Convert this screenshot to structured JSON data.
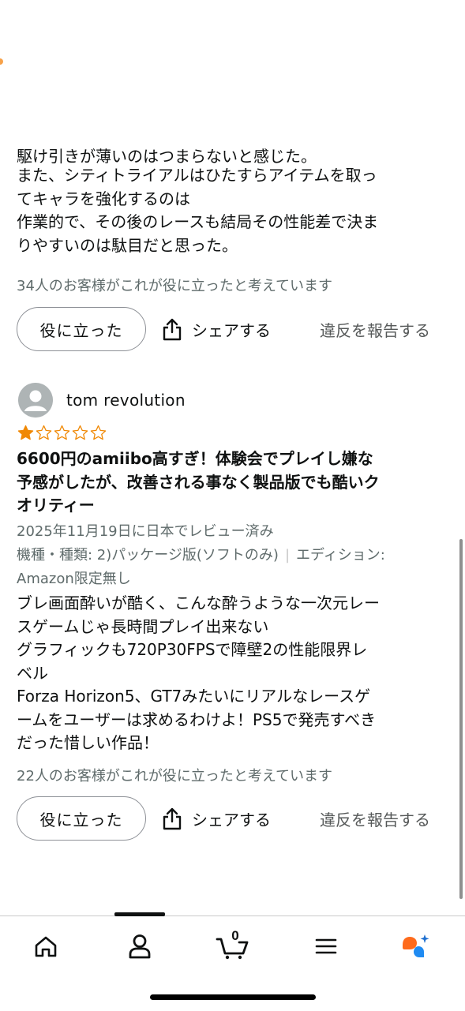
{
  "previous_review": {
    "body_lines": [
      "駆け引きが薄いのはつまらないと感じた。",
      "また、シティトライアルはひたすらアイテムを取っ",
      "てキャラを強化するのは",
      "作業的で、その後のレースも結局その性能差で決ま",
      "りやすいのは駄目だと思った。"
    ],
    "helpful_count": "34人のお客様がこれが役に立ったと考えています",
    "helpful_label": "役に立った",
    "share_label": "シェアする",
    "report_label": "違反を報告する"
  },
  "review": {
    "reviewer_name": "tom revolution",
    "rating": 1,
    "rating_max": 5,
    "star_color": "#f08804",
    "title_lines": [
      "6600円のamiibo高すぎ！体験会でプレイし嫌な",
      "予感がしたが、改善される事なく製品版でも酷いク",
      "オリティー"
    ],
    "date": "2025年11月19日に日本でレビュー済み",
    "variant": "機種・種類: 2)パッケージ版(ソフトのみ)",
    "edition_label": "エディション:",
    "edition_value": "Amazon限定無し",
    "body_lines": [
      "ブレ画面酔いが酷く、こんな酔うような一次元レー",
      "スゲームじゃ長時間プレイ出来ない",
      "グラフィックも720P30FPSで障壁2の性能限界レ",
      "ベル",
      "Forza Horizon5、GT7みたいにリアルなレースゲ",
      "ームをユーザーは求めるわけよ！PS5で発売すべき",
      "だった惜しい作品！"
    ],
    "helpful_count": "22人のお客様がこれが役に立ったと考えています",
    "helpful_label": "役に立った",
    "share_label": "シェアする",
    "report_label": "違反を報告する"
  },
  "tabbar": {
    "tabs": [
      {
        "icon": "home-icon"
      },
      {
        "icon": "account-icon"
      },
      {
        "icon": "cart-icon",
        "count": "0"
      },
      {
        "icon": "menu-icon"
      },
      {
        "icon": "rufus-assistant-icon"
      }
    ],
    "selected_index": 1
  }
}
